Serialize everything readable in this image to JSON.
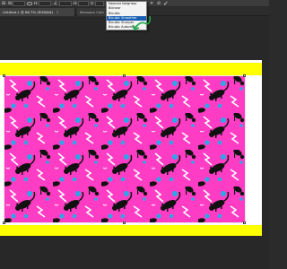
{
  "options_bar": {
    "width_label": "W:",
    "width_value": "100.00%",
    "height_label": "H:",
    "height_value": "100.00%",
    "angle_value": "0.00",
    "h_skew_label": "H:",
    "h_skew_value": "0.00",
    "v_skew_label": "V:",
    "v_skew_value": "0.00",
    "interpolation_label": "Interpolation:",
    "interpolation_value": "Bicubic Automatic"
  },
  "tabs": [
    {
      "label": "Untitled-1 @ 66.7% (RGB/8#)",
      "close": "×"
    },
    {
      "label": "Monsoon Cats",
      "close": "×"
    }
  ],
  "interpolation_options": [
    "Nearest Neighbor",
    "Bilinear",
    "Bicubic",
    "Bicubic Smoother",
    "Bicubic Sharper",
    "Bicubic Automatic"
  ],
  "interpolation_selected_index": 3,
  "colors": {
    "pattern_background": "#ff3cc4",
    "band": "#ffff00",
    "cat": "#111111",
    "accent_blue": "#2aa7e8",
    "accent_white": "#ffffff",
    "annotation": "#1fa84a"
  }
}
